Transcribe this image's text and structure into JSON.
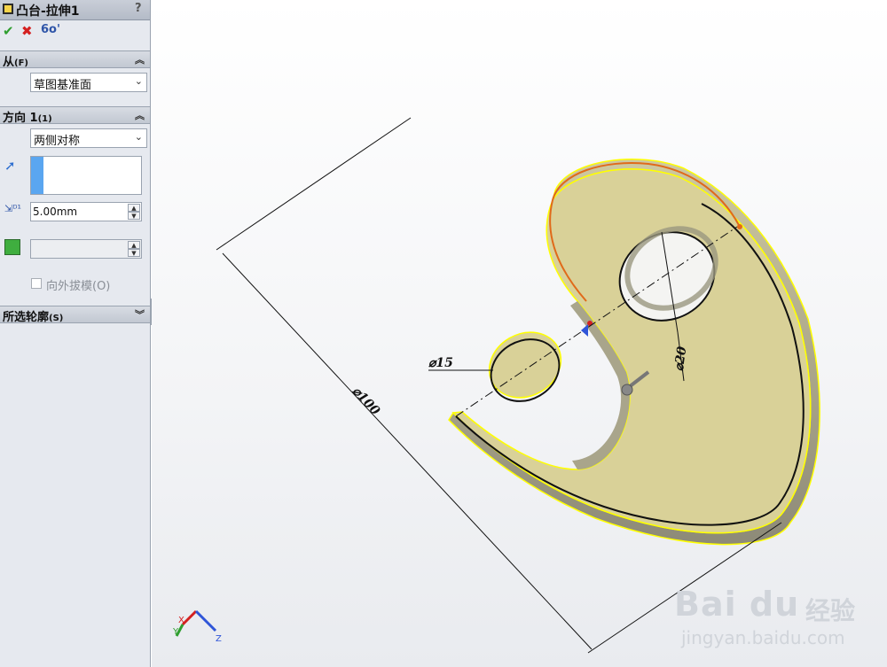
{
  "panel": {
    "title": "凸台-拉伸1",
    "help": "?",
    "actions": {
      "ok": "✔",
      "cancel": "✖",
      "preview": "6o'"
    },
    "from": {
      "header": "从",
      "shortcut": "(F)",
      "value": "草图基准面"
    },
    "direction1": {
      "header": "方向 1",
      "shortcut": "(1)",
      "end_condition": "两侧对称",
      "depth": "5.00mm",
      "draft_outward": "向外拔模(O)"
    },
    "selected_contours": {
      "header": "所选轮廓",
      "shortcut": "(S)"
    }
  },
  "viewport": {
    "dimensions": {
      "outer": "⌀100",
      "large_hole": "⌀20",
      "small_hole": "⌀15"
    },
    "triad": {
      "x": "X",
      "y": "Y",
      "z": "Z"
    }
  },
  "watermark": {
    "brand": "Bai du",
    "cn": "经验",
    "url": "jingyan.baidu.com"
  },
  "colors": {
    "part_fill": "#d9d198",
    "edge_highlight": "#ffff00",
    "selected_edge": "#e06a1a",
    "accent_blue": "#5aa6f0"
  }
}
